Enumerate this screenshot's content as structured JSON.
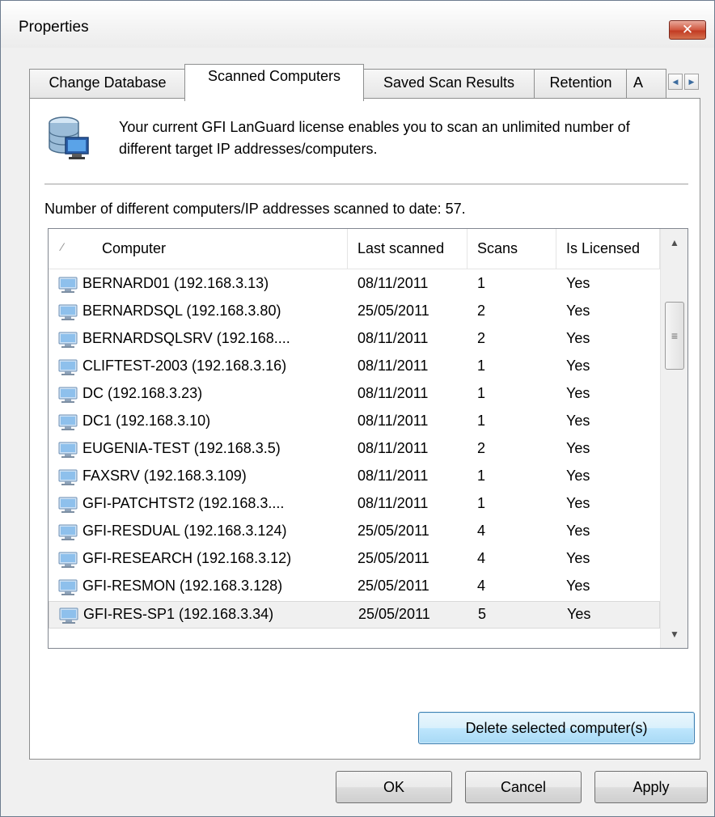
{
  "window": {
    "title": "Properties",
    "close_glyph": "✕"
  },
  "tabs": [
    {
      "label": "Change Database"
    },
    {
      "label": "Scanned Computers"
    },
    {
      "label": "Saved Scan Results"
    },
    {
      "label": "Retention"
    },
    {
      "label": "A"
    }
  ],
  "tab_scroll": {
    "left_glyph": "◀",
    "right_glyph": "▶"
  },
  "info": {
    "icon": "database-computer-icon",
    "text": "Your current GFI LanGuard license enables you to scan an unlimited number of different target IP addresses/computers."
  },
  "count_text": "Number of different computers/IP addresses scanned to date: 57.",
  "table": {
    "sort_glyph": "⁄",
    "columns": [
      "Computer",
      "Last scanned",
      "Scans",
      "Is Licensed"
    ],
    "rows": [
      {
        "computer": "BERNARD01 (192.168.3.13)",
        "last_scanned": "08/11/2011",
        "scans": "1",
        "licensed": "Yes"
      },
      {
        "computer": "BERNARDSQL (192.168.3.80)",
        "last_scanned": "25/05/2011",
        "scans": "2",
        "licensed": "Yes"
      },
      {
        "computer": "BERNARDSQLSRV (192.168....",
        "last_scanned": "08/11/2011",
        "scans": "2",
        "licensed": "Yes"
      },
      {
        "computer": "CLIFTEST-2003 (192.168.3.16)",
        "last_scanned": "08/11/2011",
        "scans": "1",
        "licensed": "Yes"
      },
      {
        "computer": "DC (192.168.3.23)",
        "last_scanned": "08/11/2011",
        "scans": "1",
        "licensed": "Yes"
      },
      {
        "computer": "DC1 (192.168.3.10)",
        "last_scanned": "08/11/2011",
        "scans": "1",
        "licensed": "Yes"
      },
      {
        "computer": "EUGENIA-TEST (192.168.3.5)",
        "last_scanned": "08/11/2011",
        "scans": "2",
        "licensed": "Yes"
      },
      {
        "computer": "FAXSRV (192.168.3.109)",
        "last_scanned": "08/11/2011",
        "scans": "1",
        "licensed": "Yes"
      },
      {
        "computer": "GFI-PATCHTST2 (192.168.3....",
        "last_scanned": "08/11/2011",
        "scans": "1",
        "licensed": "Yes"
      },
      {
        "computer": "GFI-RESDUAL (192.168.3.124)",
        "last_scanned": "25/05/2011",
        "scans": "4",
        "licensed": "Yes"
      },
      {
        "computer": "GFI-RESEARCH (192.168.3.12)",
        "last_scanned": "25/05/2011",
        "scans": "4",
        "licensed": "Yes"
      },
      {
        "computer": "GFI-RESMON (192.168.3.128)",
        "last_scanned": "25/05/2011",
        "scans": "4",
        "licensed": "Yes"
      },
      {
        "computer": "GFI-RES-SP1 (192.168.3.34)",
        "last_scanned": "25/05/2011",
        "scans": "5",
        "licensed": "Yes"
      }
    ],
    "selected_row": 12
  },
  "scrollbar": {
    "up_glyph": "▲",
    "down_glyph": "▼",
    "grip_glyph": "≡"
  },
  "buttons": {
    "delete": "Delete selected computer(s)",
    "ok": "OK",
    "cancel": "Cancel",
    "apply": "Apply"
  },
  "colors": {
    "close_button": "#c23a22",
    "focus_border": "#3c7fb1",
    "window_bg": "#f0f0f0"
  }
}
